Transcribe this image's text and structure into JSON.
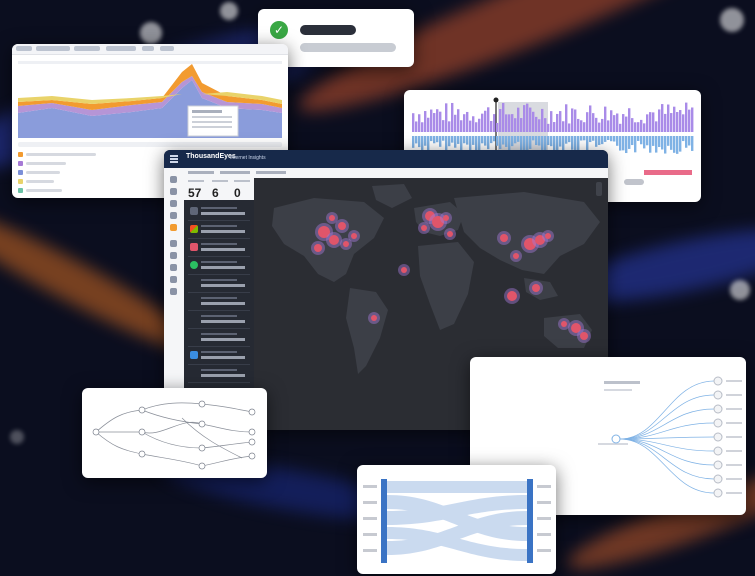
{
  "notification": {
    "status": "success"
  },
  "dashboard": {
    "app_name": "ThousandEyes",
    "module_name": "Internet Insights",
    "stats": [
      {
        "value": "57"
      },
      {
        "value": "6"
      },
      {
        "value": "0"
      }
    ]
  },
  "icons": {
    "check": "check-circle-icon",
    "menu": "hamburger-icon"
  },
  "colors": {
    "accent_orange": "#f29b30",
    "accent_purple": "#a98be8",
    "accent_blue": "#7fb2e5",
    "outage_red": "#e0556a",
    "success_green": "#3aa845",
    "nav_dark": "#17294a"
  }
}
